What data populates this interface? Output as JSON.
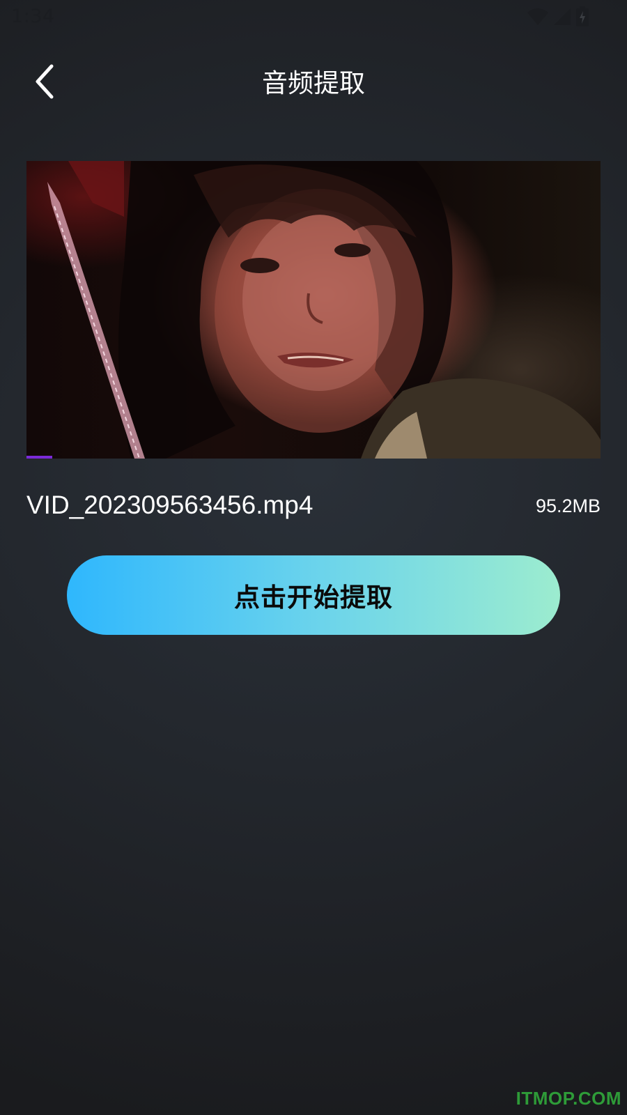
{
  "status_bar": {
    "time": "1:34",
    "icons": [
      "wifi-icon",
      "cellular-signal-icon",
      "battery-charging-icon"
    ]
  },
  "header": {
    "title": "音频提取",
    "back_icon": "chevron-left-icon"
  },
  "video": {
    "progress": 0.045,
    "progress_color": "#7b2ad8"
  },
  "file": {
    "name": "VID_202309563456.mp4",
    "size": "95.2MB"
  },
  "extract_button": {
    "label": "点击开始提取",
    "gradient_start": "#2fb7fd",
    "gradient_end": "#9ceccf"
  },
  "watermark": {
    "text": "ITMOP.COM",
    "color": "#2e9b38"
  }
}
